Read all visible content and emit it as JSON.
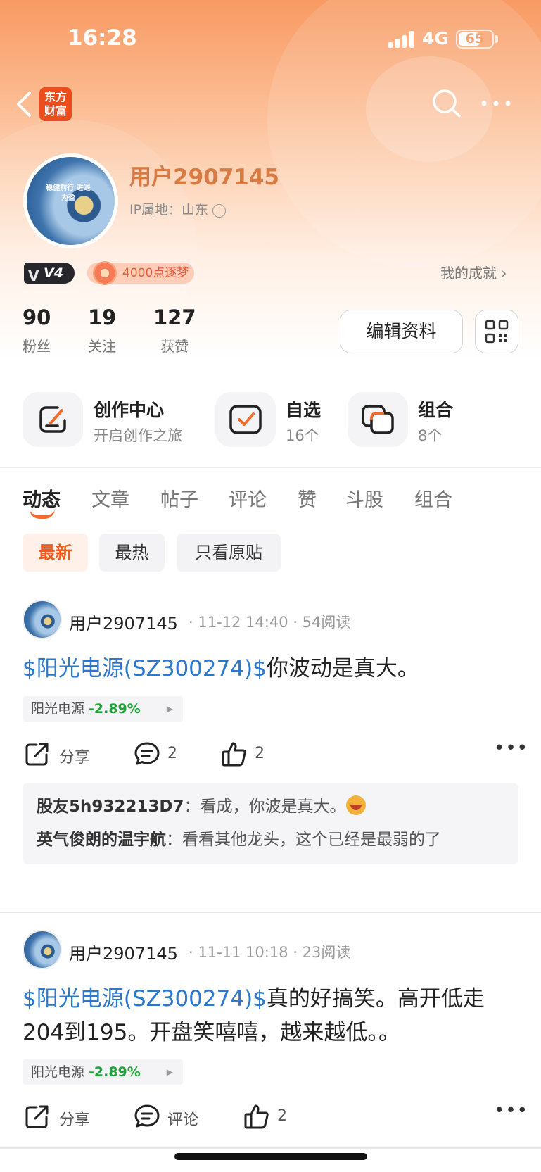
{
  "status_bar": {
    "time": "16:28",
    "network": "4G",
    "battery": "65",
    "battery_level": 0.65
  },
  "nav": {
    "logo": "东方财富",
    "back_icon": "chevron-left-icon",
    "search_icon": "search-icon",
    "more_icon": "more-horizontal-icon"
  },
  "profile": {
    "avatar_text": "稳健前行 进退为盈",
    "name": "用户2907145",
    "ip_location": "IP属地：山东",
    "level_badge": "V4",
    "points_badge": "4000点逐梦",
    "achievements": "我的成就 ›",
    "stats": [
      {
        "num": "90",
        "label": "粉丝"
      },
      {
        "num": "19",
        "label": "关注"
      },
      {
        "num": "127",
        "label": "获赞"
      }
    ],
    "edit_button": "编辑资料",
    "qr_icon": "qr-code-icon"
  },
  "quick_links": [
    {
      "title": "创作中心",
      "sub": "开启创作之旅",
      "icon": "create-icon"
    },
    {
      "title": "自选",
      "sub": "16个",
      "icon": "watchlist-check-icon"
    },
    {
      "title": "组合",
      "sub": "8个",
      "icon": "portfolio-icon"
    }
  ],
  "tabs": [
    "动态",
    "文章",
    "帖子",
    "评论",
    "赞",
    "斗股",
    "组合"
  ],
  "filters": [
    "最新",
    "最热",
    "只看原贴"
  ],
  "colors": {
    "accent": "#f26b2b",
    "stock_link": "#2a78cf",
    "down": "#1fa23a",
    "name": "#d77b45"
  },
  "posts": [
    {
      "author": "用户2907145",
      "meta": "· 11-12 14:40 · 54阅读",
      "stock_link": "$阳光电源(SZ300274)$",
      "text": "你波动是真大。",
      "tag_name": "阳光电源",
      "tag_change": "-2.89%",
      "share": "分享",
      "comments": "2",
      "likes": "2",
      "replies": [
        {
          "user": "股友5h932213D7",
          "text": "：看成，你波是真大。"
        },
        {
          "user": "英气俊朗的温宇航",
          "text": "：看看其他龙头，这个已经是最弱的了"
        }
      ]
    },
    {
      "author": "用户2907145",
      "meta": "· 11-11 10:18 · 23阅读",
      "stock_link": "$阳光电源(SZ300274)$",
      "text": "真的好搞笑。高开低走204到195。开盘笑嘻嘻，越来越低。。",
      "tag_name": "阳光电源",
      "tag_change": "-2.89%",
      "share": "分享",
      "comments": "评论",
      "likes": "2"
    }
  ]
}
